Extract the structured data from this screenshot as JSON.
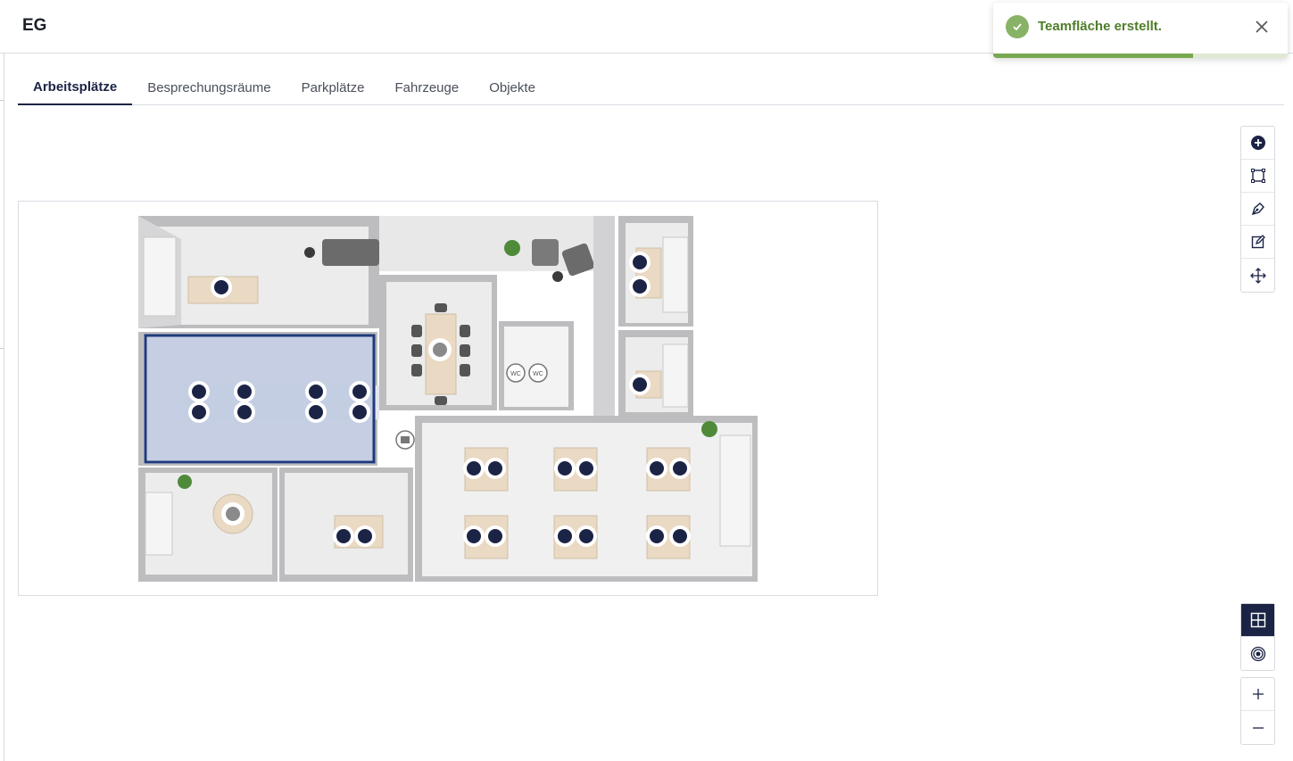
{
  "header": {
    "floor_title": "EG"
  },
  "tabs": [
    {
      "label": "Arbeitsplätze",
      "active": true
    },
    {
      "label": "Besprechungsräume",
      "active": false
    },
    {
      "label": "Parkplätze",
      "active": false
    },
    {
      "label": "Fahrzeuge",
      "active": false
    },
    {
      "label": "Objekte",
      "active": false
    }
  ],
  "toast": {
    "message": "Teamfläche erstellt.",
    "type": "success",
    "progress": 0.68,
    "accent_color": "#78a850"
  },
  "floorplan": {
    "room_labels": {
      "wc_left": "WC",
      "wc_right": "WC"
    },
    "team_area_color": "#1f3a7a",
    "desk_marker_color": "#1c2446"
  },
  "tools_edit": [
    {
      "icon": "add-circle-icon",
      "name": "add"
    },
    {
      "icon": "rectangle-select-icon",
      "name": "draw-area"
    },
    {
      "icon": "pen-tool-icon",
      "name": "draw-polygon"
    },
    {
      "icon": "edit-icon",
      "name": "edit"
    },
    {
      "icon": "move-icon",
      "name": "move"
    }
  ],
  "tools_view": [
    {
      "icon": "grid-view-icon",
      "name": "grid-view",
      "active": true
    },
    {
      "icon": "target-icon",
      "name": "target-view",
      "active": false
    }
  ],
  "tools_zoom": [
    {
      "icon": "plus-icon",
      "name": "zoom-in"
    },
    {
      "icon": "minus-icon",
      "name": "zoom-out"
    }
  ]
}
